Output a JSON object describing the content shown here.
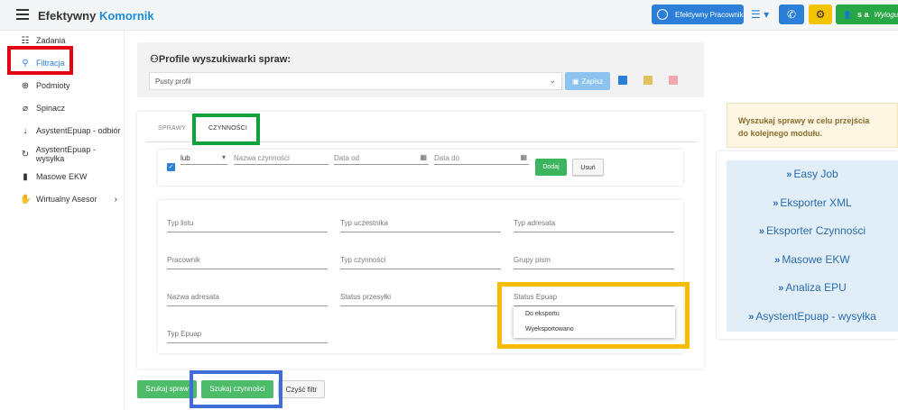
{
  "app": {
    "name_part1": "Efektywny",
    "name_part2": "Komornik"
  },
  "topbar": {
    "efektywny_pracownik": "Efektywny Pracownik",
    "user_initials": "s a",
    "logout": "Wylogu"
  },
  "sidebar": {
    "items": [
      {
        "label": "Zadania",
        "icon": "list-icon"
      },
      {
        "label": "Filtracja",
        "icon": "search-icon",
        "active": true
      },
      {
        "label": "Podmioty",
        "icon": "globe-icon"
      },
      {
        "label": "Spinacz",
        "icon": "paperclip-icon"
      },
      {
        "label": "AsystentEpuap - odbiór",
        "icon": "arrow-down-icon"
      },
      {
        "label": "AsystentEpuap - wysyłka",
        "icon": "redo-icon"
      },
      {
        "label": "Masowe EKW",
        "icon": "book-icon"
      },
      {
        "label": "Wirtualny Asesor",
        "icon": "handshake-icon",
        "submenu": true
      }
    ]
  },
  "profile": {
    "title": "Profile wyszukiwarki spraw:",
    "selected": "Pusty profil",
    "save_label": "Zapisz"
  },
  "tabs": {
    "spraw": "SPRAWY",
    "czynnosci": "CZYNNOŚCI"
  },
  "filter": {
    "logic": "lub",
    "nazwa_placeholder": "Nazwa czynności",
    "data_od": "Data od",
    "data_do": "Data do",
    "add_label": "Dodaj",
    "remove_label": "Usuń"
  },
  "grid": {
    "typ_listu": "Typ listu",
    "typ_uczestnika": "Typ uczestnika",
    "typ_adresata": "Typ adresata",
    "pracownik": "Pracownik",
    "typ_czynnosci": "Typ czynności",
    "grupy_pism": "Grupy pism",
    "nazwa_adresata": "Nazwa adresata",
    "status_przesylki": "Status przesyłki",
    "status_epuap": "Status Epuap",
    "typ_epuap": "Typ Epuap"
  },
  "dropdown": {
    "options": [
      "Do eksportu",
      "Wyeksportowano"
    ]
  },
  "actions": {
    "szukaj_spraw": "Szukaj spraw",
    "szukaj_czynnosci": "Szukaj czynności",
    "czysc_filtr": "Czyść filtr"
  },
  "info": {
    "line1": "Wyszukaj sprawy w celu przejścia",
    "line2": "do kolejnego modułu."
  },
  "modules": [
    "Easy Job",
    "Eksporter XML",
    "Eksporter Czynności",
    "Masowe EKW",
    "Analiza EPU",
    "AsystentEpuap - wysyłka"
  ],
  "colors": {
    "accent": "#2b7fd9",
    "green": "#4cbb6a",
    "yellow": "#f5c400"
  }
}
